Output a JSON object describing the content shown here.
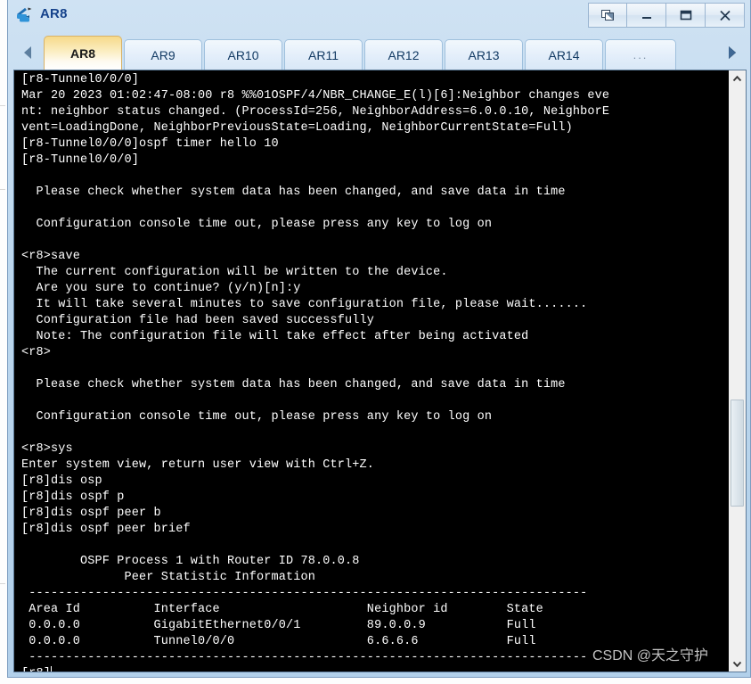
{
  "window": {
    "title": "AR8",
    "app_icon": "router-icon",
    "controls": [
      {
        "name": "restore-button",
        "glyph": "restore-icon"
      },
      {
        "name": "minimize-button",
        "glyph": "minimize-icon"
      },
      {
        "name": "maximize-button",
        "glyph": "maximize-icon"
      },
      {
        "name": "close-button",
        "glyph": "close-icon"
      }
    ]
  },
  "tabbar": {
    "scroll_left_icon": "triangle-left-icon",
    "scroll_right_icon": "triangle-right-icon",
    "tabs": [
      {
        "label": "AR8",
        "active": true
      },
      {
        "label": "AR9",
        "active": false
      },
      {
        "label": "AR10",
        "active": false
      },
      {
        "label": "AR11",
        "active": false
      },
      {
        "label": "AR12",
        "active": false
      },
      {
        "label": "AR13",
        "active": false
      },
      {
        "label": "AR14",
        "active": false
      },
      {
        "label": "...",
        "active": false
      }
    ]
  },
  "terminal": {
    "prompt_user": "<r8>",
    "prompt_system": "[r8]",
    "cursor_visible": true,
    "lines": [
      "[r8-Tunnel0/0/0]",
      "Mar 20 2023 01:02:47-08:00 r8 %%01OSPF/4/NBR_CHANGE_E(l)[6]:Neighbor changes eve",
      "nt: neighbor status changed. (ProcessId=256, NeighborAddress=6.0.0.10, NeighborE",
      "vent=LoadingDone, NeighborPreviousState=Loading, NeighborCurrentState=Full)",
      "[r8-Tunnel0/0/0]ospf timer hello 10",
      "[r8-Tunnel0/0/0]",
      "",
      "  Please check whether system data has been changed, and save data in time",
      "",
      "  Configuration console time out, please press any key to log on",
      "",
      "<r8>save",
      "  The current configuration will be written to the device.",
      "  Are you sure to continue? (y/n)[n]:y",
      "  It will take several minutes to save configuration file, please wait.......",
      "  Configuration file had been saved successfully",
      "  Note: The configuration file will take effect after being activated",
      "<r8>",
      "",
      "  Please check whether system data has been changed, and save data in time",
      "",
      "  Configuration console time out, please press any key to log on",
      "",
      "<r8>sys",
      "Enter system view, return user view with Ctrl+Z.",
      "[r8]dis osp",
      "[r8]dis ospf p",
      "[r8]dis ospf peer b",
      "[r8]dis ospf peer brief",
      "",
      "        OSPF Process 1 with Router ID 78.0.0.8",
      "              Peer Statistic Information",
      " ----------------------------------------------------------------------------",
      " Area Id          Interface                    Neighbor id        State",
      " 0.0.0.0          GigabitEthernet0/0/1         89.0.0.9           Full",
      " 0.0.0.0          Tunnel0/0/0                  6.6.6.6            Full",
      " ----------------------------------------------------------------------------",
      "[r8]"
    ],
    "ospf_table": {
      "process_header": "OSPF Process 1 with Router ID 78.0.0.8",
      "subtitle": "Peer Statistic Information",
      "columns": [
        "Area Id",
        "Interface",
        "Neighbor id",
        "State"
      ],
      "rows": [
        [
          "0.0.0.0",
          "GigabitEthernet0/0/1",
          "89.0.0.9",
          "Full"
        ],
        [
          "0.0.0.0",
          "Tunnel0/0/0",
          "6.6.6.6",
          "Full"
        ]
      ]
    },
    "watermark": "CSDN @天之守护"
  },
  "scrollbar": {
    "up_icon": "chevron-up-icon",
    "down_icon": "chevron-down-icon"
  },
  "colors": {
    "terminal_bg": "#000000",
    "terminal_fg": "#ffffff",
    "active_tab": "#f6d98a",
    "frame": "#b2d0ea",
    "title_text": "#15428b"
  }
}
